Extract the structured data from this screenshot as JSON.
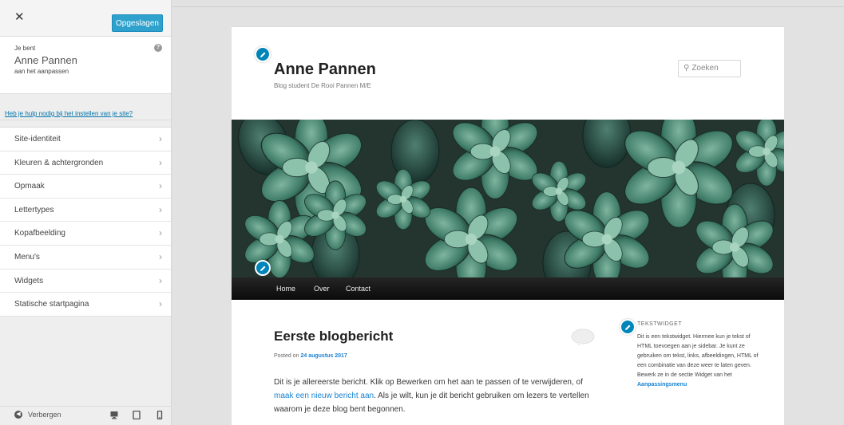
{
  "customizer": {
    "close_label": "✕",
    "save_label": "Opgeslagen",
    "info_prefix": "Je bent",
    "site_name": "Anne Pannen",
    "info_suffix": "aan het aanpassen",
    "help_icon": "?",
    "help_link": "Heb je hulp nodig bij het instellen van je site?",
    "menu": [
      {
        "label": "Site-identiteit"
      },
      {
        "label": "Kleuren & achtergronden"
      },
      {
        "label": "Opmaak"
      },
      {
        "label": "Lettertypes"
      },
      {
        "label": "Kopafbeelding"
      },
      {
        "label": "Menu's"
      },
      {
        "label": "Widgets"
      },
      {
        "label": "Statische startpagina"
      }
    ],
    "hide_label": "Verbergen",
    "devices": [
      "desktop-icon",
      "tablet-icon",
      "mobile-icon"
    ]
  },
  "site": {
    "title": "Anne Pannen",
    "description": "Blog student De Rooi Pannen M/E",
    "search_placeholder": "Zoeken",
    "nav": [
      "Home",
      "Over",
      "Contact"
    ],
    "post": {
      "title": "Eerste blogbericht",
      "meta_prefix": "Posted on ",
      "meta_date": "24 augustus 2017",
      "body_part1": "Dit is je allereerste bericht. Klik op Bewerken om het aan te passen of te verwijderen, of ",
      "body_link": "maak een nieuw bericht aan",
      "body_part2": ". Als je wilt, kun je dit bericht gebruiken om lezers te vertellen waarom je deze blog bent begonnen."
    },
    "widget": {
      "title": "TEKSTWIDGET",
      "text": "Dit is een tekstwidget. Hiermee kun je tekst of HTML toevoegen aan je sidebar. Je kunt ze gebruiken om tekst, links, afbeeldingen, HTML of een combinatie van deze weer te laten geven. Bewerk ze in de sectie Widget van het",
      "link": "Aanpassingsmenu"
    }
  },
  "colors": {
    "accent": "#2ea2cc",
    "edit_pencil": "#0085ba",
    "link": "#1982d1",
    "nav_bg": "#111111"
  }
}
